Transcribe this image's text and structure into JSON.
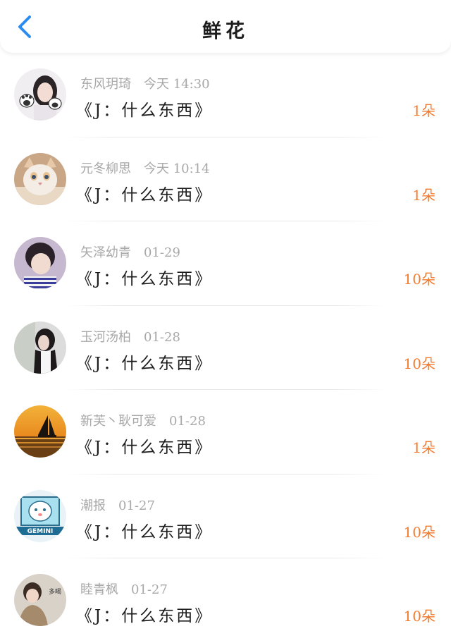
{
  "header": {
    "title": "鲜花",
    "back_icon": "chevron-left-icon",
    "accent_color": "#2a8cf0"
  },
  "colors": {
    "count": "#f07a2f",
    "meta": "#a8a8a8"
  },
  "items": [
    {
      "user": "东风玥琦",
      "time": "今天 14:30",
      "book": "《J：什么东西》",
      "count": "1朵"
    },
    {
      "user": "元冬柳思",
      "time": "今天 10:14",
      "book": "《J：什么东西》",
      "count": "1朵"
    },
    {
      "user": "矢泽幼青",
      "time": "01-29",
      "book": "《J：什么东西》",
      "count": "10朵"
    },
    {
      "user": "玉河汤柏",
      "time": "01-28",
      "book": "《J：什么东西》",
      "count": "10朵"
    },
    {
      "user": "新芙丶耿可爱",
      "time": "01-28",
      "book": "《J：什么东西》",
      "count": "1朵"
    },
    {
      "user": "潮报",
      "time": "01-27",
      "book": "《J：什么东西》",
      "count": "10朵"
    },
    {
      "user": "睦青枫",
      "time": "01-27",
      "book": "《J：什么东西》",
      "count": "10朵"
    }
  ]
}
